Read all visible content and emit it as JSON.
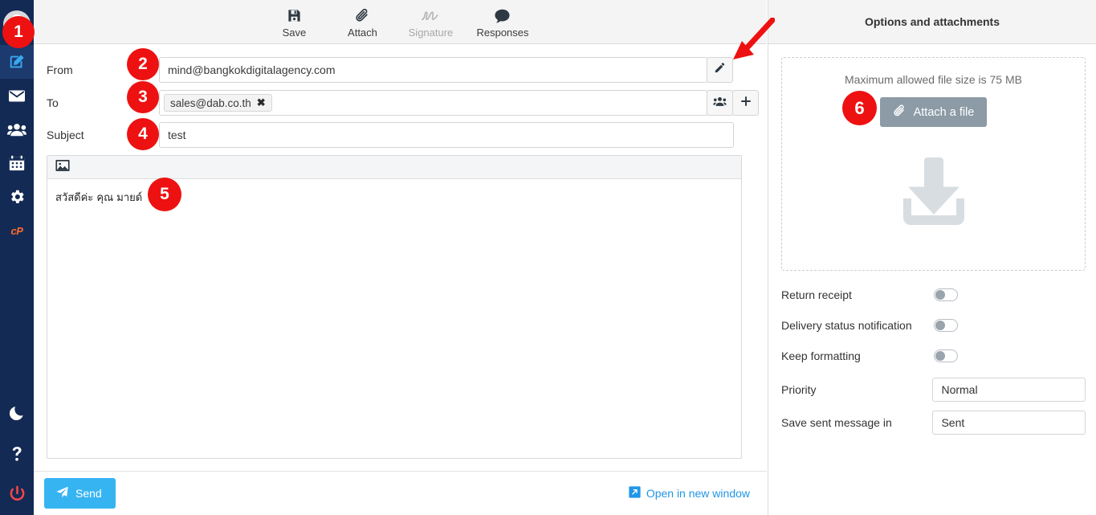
{
  "sidebar": {
    "items": [
      {
        "name": "avatar",
        "label": "User avatar"
      },
      {
        "name": "compose",
        "label": "Compose"
      },
      {
        "name": "mail",
        "label": "Mail"
      },
      {
        "name": "contacts",
        "label": "Contacts"
      },
      {
        "name": "calendar",
        "label": "Calendar"
      },
      {
        "name": "settings",
        "label": "Settings"
      },
      {
        "name": "cpanel",
        "label": "cP"
      },
      {
        "name": "dark-mode",
        "label": "Dark mode"
      },
      {
        "name": "help",
        "label": "Help"
      },
      {
        "name": "logout",
        "label": "Log out"
      }
    ],
    "cpanel_label": "cP",
    "bg_color": "#132a54",
    "active_bg_color": "#1c3a6e",
    "logout_color": "#f9464a"
  },
  "toolbar": {
    "save_label": "Save",
    "attach_label": "Attach",
    "signature_label": "Signature",
    "responses_label": "Responses"
  },
  "compose": {
    "from_label": "From",
    "from_value": "mind@bangkokdigitalagency.com",
    "to_label": "To",
    "to_chip": "sales@dab.co.th",
    "to_chip_remove": "✖",
    "subject_label": "Subject",
    "subject_value": "test",
    "body_text": "สวัสดีค่ะ คุณ มายด์",
    "send_label": "Send",
    "open_new_window_label": "Open in new window",
    "send_color": "#36b4f2",
    "link_color": "#2196e8"
  },
  "options_panel": {
    "title": "Options and attachments",
    "dropzone_text": "Maximum allowed file size is 75 MB",
    "attach_file_label": "Attach a file",
    "attach_button_color": "#8c9ba5",
    "rows": [
      {
        "label": "Return receipt",
        "type": "toggle",
        "value": "off"
      },
      {
        "label": "Delivery status notification",
        "type": "toggle",
        "value": "off"
      },
      {
        "label": "Keep formatting",
        "type": "toggle",
        "value": "off"
      },
      {
        "label": "Priority",
        "type": "select",
        "value": "Normal"
      },
      {
        "label": "Save sent message in",
        "type": "select",
        "value": "Sent"
      }
    ]
  },
  "annotations": {
    "badges": [
      {
        "number": "1",
        "target": "sidebar-compose"
      },
      {
        "number": "2",
        "target": "from-field"
      },
      {
        "number": "3",
        "target": "to-field"
      },
      {
        "number": "4",
        "target": "subject-field"
      },
      {
        "number": "5",
        "target": "message-body"
      },
      {
        "number": "6",
        "target": "attach-a-file-button"
      }
    ],
    "arrow": {
      "color": "#ee1111",
      "points_to": "from-edit-button"
    },
    "badge_color": "#ee1111"
  }
}
